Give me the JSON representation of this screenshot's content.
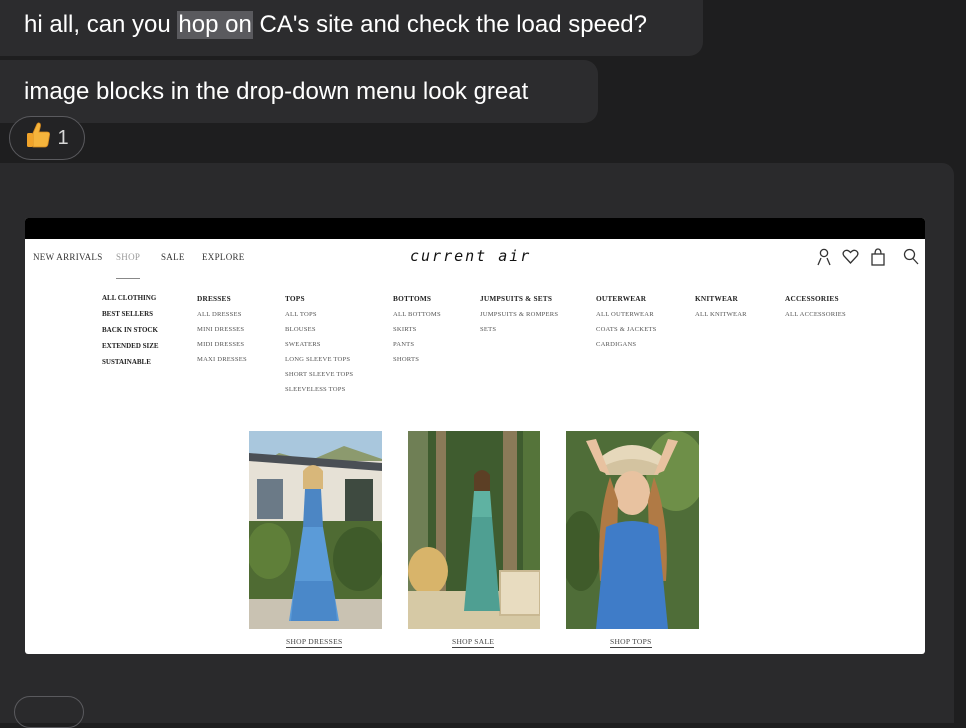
{
  "messages": [
    {
      "before": "hi all, can you ",
      "highlight": "hop on",
      "after": " CA's site and check the load speed?"
    },
    {
      "text": "image blocks in the drop-down menu look great"
    }
  ],
  "reaction": {
    "emoji": "👍",
    "count": "1"
  },
  "screenshot": {
    "nav": [
      "NEW ARRIVALS",
      "SHOP",
      "SALE",
      "EXPLORE"
    ],
    "logo": "current air",
    "columns": [
      {
        "items": [
          "ALL CLOTHING",
          "BEST SELLERS",
          "BACK IN STOCK",
          "EXTENDED SIZE",
          "SUSTAINABLE"
        ]
      },
      {
        "header": "DRESSES",
        "items": [
          "ALL DRESSES",
          "MINI DRESSES",
          "MIDI DRESSES",
          "MAXI DRESSES"
        ]
      },
      {
        "header": "TOPS",
        "items": [
          "ALL TOPS",
          "BLOUSES",
          "SWEATERS",
          "LONG SLEEVE TOPS",
          "SHORT SLEEVE TOPS",
          "SLEEVELESS TOPS"
        ]
      },
      {
        "header": "BOTTOMS",
        "items": [
          "ALL BOTTOMS",
          "SKIRTS",
          "PANTS",
          "SHORTS"
        ]
      },
      {
        "header": "JUMPSUITS & SETS",
        "items": [
          "JUMPSUITS & ROMPERS",
          "SETS"
        ]
      },
      {
        "header": "OUTERWEAR",
        "items": [
          "ALL OUTERWEAR",
          "COATS & JACKETS",
          "CARDIGANS"
        ]
      },
      {
        "header": "KNITWEAR",
        "items": [
          "ALL KNITWEAR"
        ]
      },
      {
        "header": "ACCESSORIES",
        "items": [
          "ALL ACCESSORIES"
        ]
      }
    ],
    "promos": [
      "SHOP DRESSES",
      "SHOP SALE",
      "SHOP TOPS"
    ]
  },
  "icons": [
    "thumbs-up-icon",
    "user-icon",
    "heart-icon",
    "bag-icon",
    "search-icon"
  ],
  "colors": {
    "background": "#1e1e1f",
    "bubble": "#2c2c2e",
    "highlight": "#5a5a5e"
  }
}
